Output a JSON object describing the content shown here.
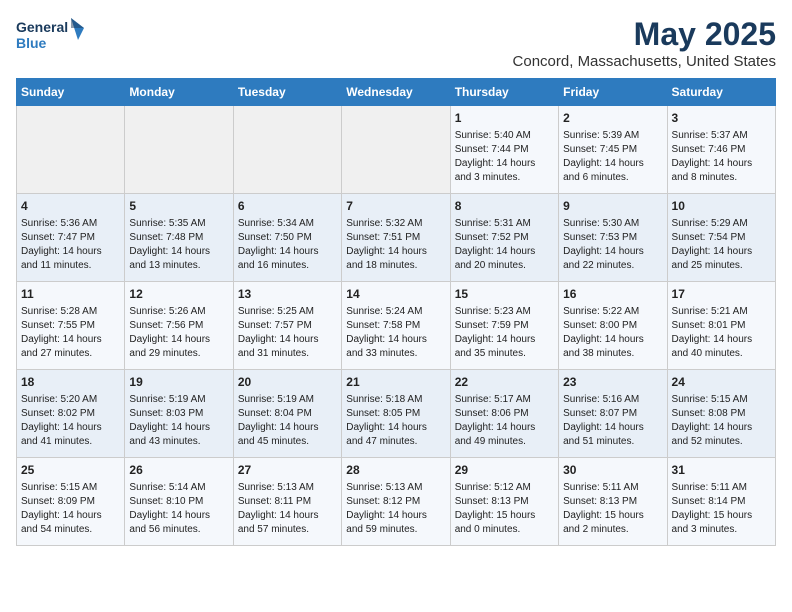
{
  "header": {
    "logo_line1": "General",
    "logo_line2": "Blue",
    "title": "May 2025",
    "subtitle": "Concord, Massachusetts, United States"
  },
  "weekdays": [
    "Sunday",
    "Monday",
    "Tuesday",
    "Wednesday",
    "Thursday",
    "Friday",
    "Saturday"
  ],
  "weeks": [
    [
      {
        "day": "",
        "info": ""
      },
      {
        "day": "",
        "info": ""
      },
      {
        "day": "",
        "info": ""
      },
      {
        "day": "",
        "info": ""
      },
      {
        "day": "1",
        "info": "Sunrise: 5:40 AM\nSunset: 7:44 PM\nDaylight: 14 hours\nand 3 minutes."
      },
      {
        "day": "2",
        "info": "Sunrise: 5:39 AM\nSunset: 7:45 PM\nDaylight: 14 hours\nand 6 minutes."
      },
      {
        "day": "3",
        "info": "Sunrise: 5:37 AM\nSunset: 7:46 PM\nDaylight: 14 hours\nand 8 minutes."
      }
    ],
    [
      {
        "day": "4",
        "info": "Sunrise: 5:36 AM\nSunset: 7:47 PM\nDaylight: 14 hours\nand 11 minutes."
      },
      {
        "day": "5",
        "info": "Sunrise: 5:35 AM\nSunset: 7:48 PM\nDaylight: 14 hours\nand 13 minutes."
      },
      {
        "day": "6",
        "info": "Sunrise: 5:34 AM\nSunset: 7:50 PM\nDaylight: 14 hours\nand 16 minutes."
      },
      {
        "day": "7",
        "info": "Sunrise: 5:32 AM\nSunset: 7:51 PM\nDaylight: 14 hours\nand 18 minutes."
      },
      {
        "day": "8",
        "info": "Sunrise: 5:31 AM\nSunset: 7:52 PM\nDaylight: 14 hours\nand 20 minutes."
      },
      {
        "day": "9",
        "info": "Sunrise: 5:30 AM\nSunset: 7:53 PM\nDaylight: 14 hours\nand 22 minutes."
      },
      {
        "day": "10",
        "info": "Sunrise: 5:29 AM\nSunset: 7:54 PM\nDaylight: 14 hours\nand 25 minutes."
      }
    ],
    [
      {
        "day": "11",
        "info": "Sunrise: 5:28 AM\nSunset: 7:55 PM\nDaylight: 14 hours\nand 27 minutes."
      },
      {
        "day": "12",
        "info": "Sunrise: 5:26 AM\nSunset: 7:56 PM\nDaylight: 14 hours\nand 29 minutes."
      },
      {
        "day": "13",
        "info": "Sunrise: 5:25 AM\nSunset: 7:57 PM\nDaylight: 14 hours\nand 31 minutes."
      },
      {
        "day": "14",
        "info": "Sunrise: 5:24 AM\nSunset: 7:58 PM\nDaylight: 14 hours\nand 33 minutes."
      },
      {
        "day": "15",
        "info": "Sunrise: 5:23 AM\nSunset: 7:59 PM\nDaylight: 14 hours\nand 35 minutes."
      },
      {
        "day": "16",
        "info": "Sunrise: 5:22 AM\nSunset: 8:00 PM\nDaylight: 14 hours\nand 38 minutes."
      },
      {
        "day": "17",
        "info": "Sunrise: 5:21 AM\nSunset: 8:01 PM\nDaylight: 14 hours\nand 40 minutes."
      }
    ],
    [
      {
        "day": "18",
        "info": "Sunrise: 5:20 AM\nSunset: 8:02 PM\nDaylight: 14 hours\nand 41 minutes."
      },
      {
        "day": "19",
        "info": "Sunrise: 5:19 AM\nSunset: 8:03 PM\nDaylight: 14 hours\nand 43 minutes."
      },
      {
        "day": "20",
        "info": "Sunrise: 5:19 AM\nSunset: 8:04 PM\nDaylight: 14 hours\nand 45 minutes."
      },
      {
        "day": "21",
        "info": "Sunrise: 5:18 AM\nSunset: 8:05 PM\nDaylight: 14 hours\nand 47 minutes."
      },
      {
        "day": "22",
        "info": "Sunrise: 5:17 AM\nSunset: 8:06 PM\nDaylight: 14 hours\nand 49 minutes."
      },
      {
        "day": "23",
        "info": "Sunrise: 5:16 AM\nSunset: 8:07 PM\nDaylight: 14 hours\nand 51 minutes."
      },
      {
        "day": "24",
        "info": "Sunrise: 5:15 AM\nSunset: 8:08 PM\nDaylight: 14 hours\nand 52 minutes."
      }
    ],
    [
      {
        "day": "25",
        "info": "Sunrise: 5:15 AM\nSunset: 8:09 PM\nDaylight: 14 hours\nand 54 minutes."
      },
      {
        "day": "26",
        "info": "Sunrise: 5:14 AM\nSunset: 8:10 PM\nDaylight: 14 hours\nand 56 minutes."
      },
      {
        "day": "27",
        "info": "Sunrise: 5:13 AM\nSunset: 8:11 PM\nDaylight: 14 hours\nand 57 minutes."
      },
      {
        "day": "28",
        "info": "Sunrise: 5:13 AM\nSunset: 8:12 PM\nDaylight: 14 hours\nand 59 minutes."
      },
      {
        "day": "29",
        "info": "Sunrise: 5:12 AM\nSunset: 8:13 PM\nDaylight: 15 hours\nand 0 minutes."
      },
      {
        "day": "30",
        "info": "Sunrise: 5:11 AM\nSunset: 8:13 PM\nDaylight: 15 hours\nand 2 minutes."
      },
      {
        "day": "31",
        "info": "Sunrise: 5:11 AM\nSunset: 8:14 PM\nDaylight: 15 hours\nand 3 minutes."
      }
    ]
  ]
}
